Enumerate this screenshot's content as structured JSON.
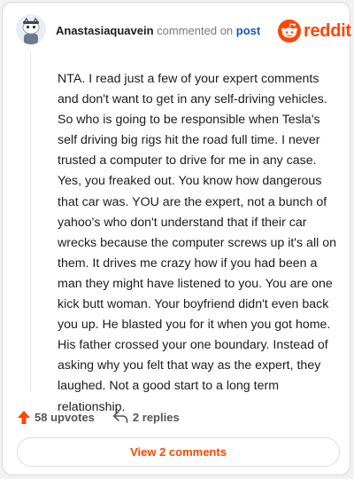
{
  "header": {
    "username": "Anastasiaquavein",
    "action_text": "commented on",
    "post_link": "post",
    "brand": "reddit"
  },
  "comment": {
    "paragraphs": [
      "NTA. I read just a few of your expert comments and don't want to get in any self-driving vehicles. So who is going to be responsible when Tesla's self driving big rigs hit the road full time. I never trusted a computer to drive for me in any case. Yes, you freaked out. You know how dangerous that car was. YOU are the expert, not a bunch of yahoo's who don't understand that if their car wrecks because the computer screws up it's all on them. It drives me crazy how if you had been a man they might have listened to you. You are one kick butt woman. Your boyfriend didn't even back you up. He blasted you for it when you got home. His father crossed your one boundary. Instead of asking why you felt that way as the expert, they laughed. Not a good start to a long term relationship."
    ]
  },
  "actions": {
    "upvotes": "58 upvotes",
    "replies": "2 replies"
  },
  "footer": {
    "view_comments": "View 2 comments"
  },
  "colors": {
    "brand_orange": "#ff4500",
    "link_blue": "#0b57d0"
  },
  "icons": {
    "avatar": "snoo-avatar",
    "logo": "reddit-logo-icon",
    "upvote": "upvote-arrow-icon",
    "reply": "reply-arrow-icon"
  }
}
